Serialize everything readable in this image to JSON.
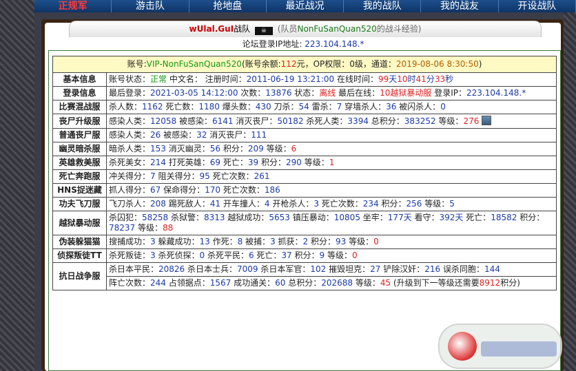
{
  "nav": {
    "items": [
      "正规军",
      "游击队",
      "抢地盘",
      "最近战况",
      "我的战队",
      "我的战友",
      "开设战队"
    ],
    "active_index": 0
  },
  "header": {
    "username": "wUlal.GuI",
    "team_label": "战队",
    "flag_icon": "pirate-flag-icon",
    "member_text": "(队员",
    "player_name": "NonFuSanQuan520",
    "suffix": "的战斗经验)"
  },
  "ip_line": {
    "label": "论坛登录IP地址:",
    "value": "223.104.148.*"
  },
  "account": {
    "text1": "账号:",
    "account_name": "VIP-NonFuSanQuan520",
    "text2": "(账号余额:",
    "balance": "112",
    "text3": "元，OP权限：",
    "op": "0级",
    "text4": "，通道：",
    "channel_time": "2019-08-06 8:30:50",
    "text5": ")"
  },
  "rows": [
    {
      "label": "基本信息",
      "segments": [
        {
          "t": "账号状态："
        },
        {
          "t": "正常",
          "c": "g"
        },
        {
          "t": " 中文名： 注册时间："
        },
        {
          "t": "2011-06-19 13:21:00",
          "c": "b"
        },
        {
          "t": " 在线时间："
        },
        {
          "t": "99",
          "c": "r"
        },
        {
          "t": "天",
          "c": "b"
        },
        {
          "t": "10",
          "c": "r"
        },
        {
          "t": "时",
          "c": "b"
        },
        {
          "t": "41",
          "c": "r"
        },
        {
          "t": "分",
          "c": "b"
        },
        {
          "t": "33",
          "c": "r"
        },
        {
          "t": "秒",
          "c": "b"
        }
      ]
    },
    {
      "label": "登录信息",
      "segments": [
        {
          "t": "最后登录："
        },
        {
          "t": "2021-03-05 14:12:00",
          "c": "b"
        },
        {
          "t": " 次数："
        },
        {
          "t": "13876",
          "c": "b"
        },
        {
          "t": " 状态："
        },
        {
          "t": "离线",
          "c": "r"
        },
        {
          "t": " 最后在线："
        },
        {
          "t": "10越狱暴动服",
          "c": "r"
        },
        {
          "t": " 登录IP："
        },
        {
          "t": "223.104.148.*",
          "c": "b"
        }
      ]
    },
    {
      "label": "比赛混战服",
      "segments": [
        {
          "t": "杀人数："
        },
        {
          "t": "1162",
          "c": "b"
        },
        {
          "t": " 死亡数："
        },
        {
          "t": "1180",
          "c": "b"
        },
        {
          "t": " 爆头数："
        },
        {
          "t": "430",
          "c": "b"
        },
        {
          "t": " 刀杀："
        },
        {
          "t": "54",
          "c": "b"
        },
        {
          "t": " 雷杀："
        },
        {
          "t": "7",
          "c": "b"
        },
        {
          "t": " 穿墙杀人："
        },
        {
          "t": "36",
          "c": "b"
        },
        {
          "t": " 被闪杀人："
        },
        {
          "t": "0",
          "c": "b"
        }
      ]
    },
    {
      "label": "丧尸升级服",
      "avatar": true,
      "segments": [
        {
          "t": "感染人类："
        },
        {
          "t": "12058",
          "c": "b"
        },
        {
          "t": " 被感染："
        },
        {
          "t": "6141",
          "c": "b"
        },
        {
          "t": " 消灭丧尸："
        },
        {
          "t": "50182",
          "c": "b"
        },
        {
          "t": " 杀死人类："
        },
        {
          "t": "3394",
          "c": "b"
        },
        {
          "t": " 总积分："
        },
        {
          "t": "383252",
          "c": "b"
        },
        {
          "t": " 等级："
        },
        {
          "t": "276",
          "c": "r"
        }
      ]
    },
    {
      "label": "普通丧尸服",
      "segments": [
        {
          "t": "感染人类："
        },
        {
          "t": "26",
          "c": "b"
        },
        {
          "t": " 被感染："
        },
        {
          "t": "32",
          "c": "b"
        },
        {
          "t": " 消灭丧尸："
        },
        {
          "t": "111",
          "c": "b"
        }
      ]
    },
    {
      "label": "幽灵暗杀服",
      "segments": [
        {
          "t": "暗杀人类："
        },
        {
          "t": "153",
          "c": "b"
        },
        {
          "t": " 消灭幽灵："
        },
        {
          "t": "56",
          "c": "b"
        },
        {
          "t": " 积分："
        },
        {
          "t": "209",
          "c": "b"
        },
        {
          "t": " 等级："
        },
        {
          "t": "6",
          "c": "r"
        }
      ]
    },
    {
      "label": "英雄救美服",
      "segments": [
        {
          "t": "杀死美女："
        },
        {
          "t": "214",
          "c": "b"
        },
        {
          "t": " 打死英雄："
        },
        {
          "t": "69",
          "c": "b"
        },
        {
          "t": " 死亡："
        },
        {
          "t": "39",
          "c": "b"
        },
        {
          "t": " 积分："
        },
        {
          "t": "290",
          "c": "b"
        },
        {
          "t": " 等级："
        },
        {
          "t": "1",
          "c": "r"
        }
      ]
    },
    {
      "label": "死亡奔跑服",
      "segments": [
        {
          "t": "冲关得分："
        },
        {
          "t": "7",
          "c": "b"
        },
        {
          "t": " 阻关得分："
        },
        {
          "t": "95",
          "c": "b"
        },
        {
          "t": " 死亡次数："
        },
        {
          "t": "261",
          "c": "b"
        }
      ]
    },
    {
      "label": "HNS捉迷藏",
      "segments": [
        {
          "t": "抓人得分："
        },
        {
          "t": "67",
          "c": "b"
        },
        {
          "t": " 保命得分："
        },
        {
          "t": "170",
          "c": "b"
        },
        {
          "t": " 死亡次数："
        },
        {
          "t": "186",
          "c": "b"
        }
      ]
    },
    {
      "label": "功夫飞刀服",
      "segments": [
        {
          "t": "飞刀杀人："
        },
        {
          "t": "208",
          "c": "b"
        },
        {
          "t": " 踢死敌人："
        },
        {
          "t": "41",
          "c": "b"
        },
        {
          "t": " 开车撞人："
        },
        {
          "t": "4",
          "c": "b"
        },
        {
          "t": " 开枪杀人："
        },
        {
          "t": "3",
          "c": "b"
        },
        {
          "t": " 死亡次数："
        },
        {
          "t": "234",
          "c": "b"
        },
        {
          "t": " 积分："
        },
        {
          "t": "256",
          "c": "b"
        },
        {
          "t": " 等级："
        },
        {
          "t": "5",
          "c": "b"
        }
      ]
    },
    {
      "label": "越狱暴动服",
      "segments": [
        {
          "t": "杀囚犯："
        },
        {
          "t": "58258",
          "c": "b"
        },
        {
          "t": " 杀狱警："
        },
        {
          "t": "8313",
          "c": "b"
        },
        {
          "t": " 越狱成功："
        },
        {
          "t": "5653",
          "c": "b"
        },
        {
          "t": " 镇压暴动："
        },
        {
          "t": "10805",
          "c": "b"
        },
        {
          "t": " 坐牢："
        },
        {
          "t": "177天",
          "c": "b"
        },
        {
          "t": " 看守："
        },
        {
          "t": "392天",
          "c": "b"
        },
        {
          "t": " 死亡："
        },
        {
          "t": "18582",
          "c": "b"
        },
        {
          "t": " 积分："
        },
        {
          "t": "78237",
          "c": "b"
        },
        {
          "t": " 等级："
        },
        {
          "t": "88",
          "c": "r"
        }
      ]
    },
    {
      "label": "伪装躲猫猫",
      "segments": [
        {
          "t": "搜捕成功："
        },
        {
          "t": "3",
          "c": "b"
        },
        {
          "t": " 躲藏成功："
        },
        {
          "t": "13",
          "c": "b"
        },
        {
          "t": " 作死："
        },
        {
          "t": "8",
          "c": "b"
        },
        {
          "t": " 被捕："
        },
        {
          "t": "3",
          "c": "b"
        },
        {
          "t": " 抓获："
        },
        {
          "t": "2",
          "c": "b"
        },
        {
          "t": " 积分："
        },
        {
          "t": "93",
          "c": "b"
        },
        {
          "t": " 等级："
        },
        {
          "t": "0",
          "c": "r"
        }
      ]
    },
    {
      "label": "侦探叛徒TT",
      "segments": [
        {
          "t": "杀死叛徒："
        },
        {
          "t": "3",
          "c": "b"
        },
        {
          "t": " 杀死侦探："
        },
        {
          "t": "0",
          "c": "b"
        },
        {
          "t": " 杀死平民："
        },
        {
          "t": "6",
          "c": "b"
        },
        {
          "t": " 死亡："
        },
        {
          "t": "37",
          "c": "b"
        },
        {
          "t": " 积分："
        },
        {
          "t": "9",
          "c": "b"
        },
        {
          "t": " 等级："
        },
        {
          "t": "0",
          "c": "r"
        }
      ]
    },
    {
      "label": "抗日战争服",
      "segments": [
        {
          "t": "杀日本平民："
        },
        {
          "t": "20826",
          "c": "b"
        },
        {
          "t": " 杀日本士兵："
        },
        {
          "t": "7009",
          "c": "b"
        },
        {
          "t": " 杀日本军官："
        },
        {
          "t": "102",
          "c": "b"
        },
        {
          "t": " 摧毁坦克："
        },
        {
          "t": "27",
          "c": "b"
        },
        {
          "t": " 铲除汉奸："
        },
        {
          "t": "216",
          "c": "b"
        },
        {
          "t": " 误杀同胞："
        },
        {
          "t": "144",
          "c": "b"
        }
      ],
      "segments2": [
        {
          "t": "阵亡次数："
        },
        {
          "t": "244",
          "c": "b"
        },
        {
          "t": " 占领据点："
        },
        {
          "t": "1567",
          "c": "b"
        },
        {
          "t": " 成功通关："
        },
        {
          "t": "60",
          "c": "b"
        },
        {
          "t": " 总积分："
        },
        {
          "t": "202688",
          "c": "b"
        },
        {
          "t": " 等级："
        },
        {
          "t": "45",
          "c": "r"
        },
        {
          "t": " (升级到下一等级还需要"
        },
        {
          "t": "8912",
          "c": "r"
        },
        {
          "t": "积分)"
        }
      ]
    }
  ]
}
